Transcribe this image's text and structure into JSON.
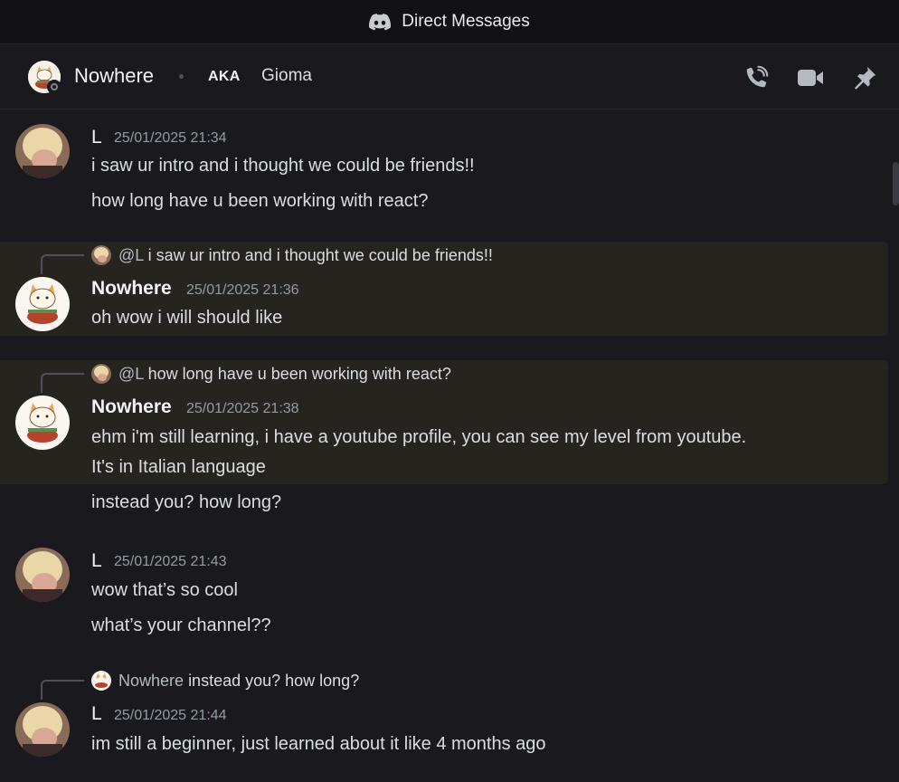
{
  "window": {
    "title": "Direct Messages",
    "icon": "discord-logo-icon"
  },
  "header": {
    "name": "Nowhere",
    "aka_label": "AKA",
    "nickname": "Gioma",
    "status": "offline",
    "actions": [
      "voice-call-icon",
      "video-call-icon",
      "pin-icon"
    ]
  },
  "colors": {
    "background": "#1a1a1e",
    "titlebar": "#121214",
    "highlight": "#26241f",
    "timestamp": "#949ba4",
    "text": "#dbdee1"
  },
  "messages": [
    {
      "author": "L",
      "timestamp": "25/01/2025 21:34",
      "lines": [
        "i saw ur intro and i thought we could be friends!!",
        "how long have u been working with react?"
      ]
    },
    {
      "reply_to": {
        "mention": "@L",
        "text": "i saw ur intro and i thought we could be friends!!"
      },
      "author": "Nowhere",
      "timestamp": "25/01/2025 21:36",
      "lines": [
        "oh wow i will should like"
      ]
    },
    {
      "reply_to": {
        "mention": "@L",
        "text": "how long have u been working with react?"
      },
      "author": "Nowhere",
      "timestamp": "25/01/2025 21:38",
      "lines": [
        "ehm i'm still learning, i have a youtube profile, you can see my level from youtube.",
        "It's in Italian language"
      ]
    },
    {
      "continuation": true,
      "lines": [
        "instead you? how long?"
      ]
    },
    {
      "author": "L",
      "timestamp": "25/01/2025 21:43",
      "lines": [
        "wow that’s so cool",
        "what’s your channel??"
      ]
    },
    {
      "reply_to": {
        "mention": "Nowhere",
        "text": "instead you? how long?"
      },
      "author": "L",
      "timestamp": "25/01/2025 21:44",
      "lines": [
        "im still a beginner, just learned about it like 4 months ago"
      ]
    }
  ]
}
